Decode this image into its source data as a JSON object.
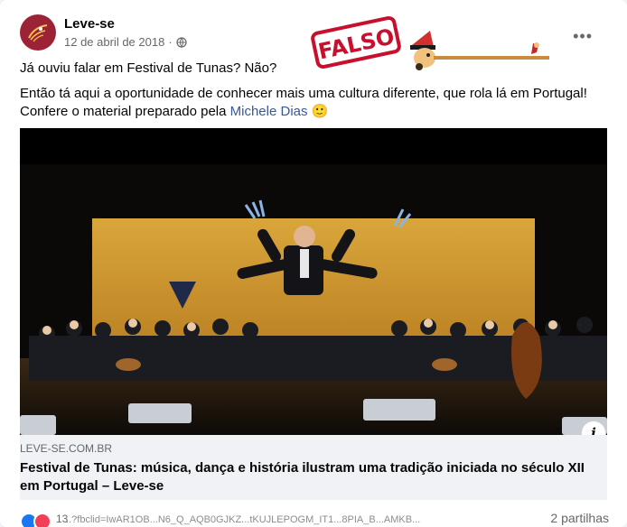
{
  "post": {
    "page_name": "Leve-se",
    "date": "12 de abril de 2018",
    "privacy_icon": "globe-icon",
    "more_label": "•••",
    "stamp_text": "FALSO",
    "paragraph1": "Já ouviu falar em Festival de Tunas? Não?",
    "paragraph2_part1": "Então tá aqui a oportunidade de conhecer mais uma cultura diferente, que rola lá em Portugal! Confere o material preparado pela ",
    "mention": "Michele Dias",
    "emoji": "🙂"
  },
  "link_preview": {
    "domain": "LEVE-SE.COM.BR",
    "title": "Festival de Tunas: música, dança e história ilustram uma tradição iniciada no século XII em Portugal – Leve-se",
    "info_label": "i"
  },
  "footer": {
    "reaction_count": "13",
    "shares": "2 partilhas",
    "url_fragment": "...?fbclid=IwAR1OB...N6_Q_AQB0GJKZ...tKUJLEPOGM_IT1...8PIA_B...AMKB..."
  },
  "colors": {
    "brand_avatar": "#9b2335",
    "stamp_red": "#c8102e",
    "mention_blue": "#385898",
    "like_blue": "#1877f2",
    "love_red": "#f33e58"
  }
}
